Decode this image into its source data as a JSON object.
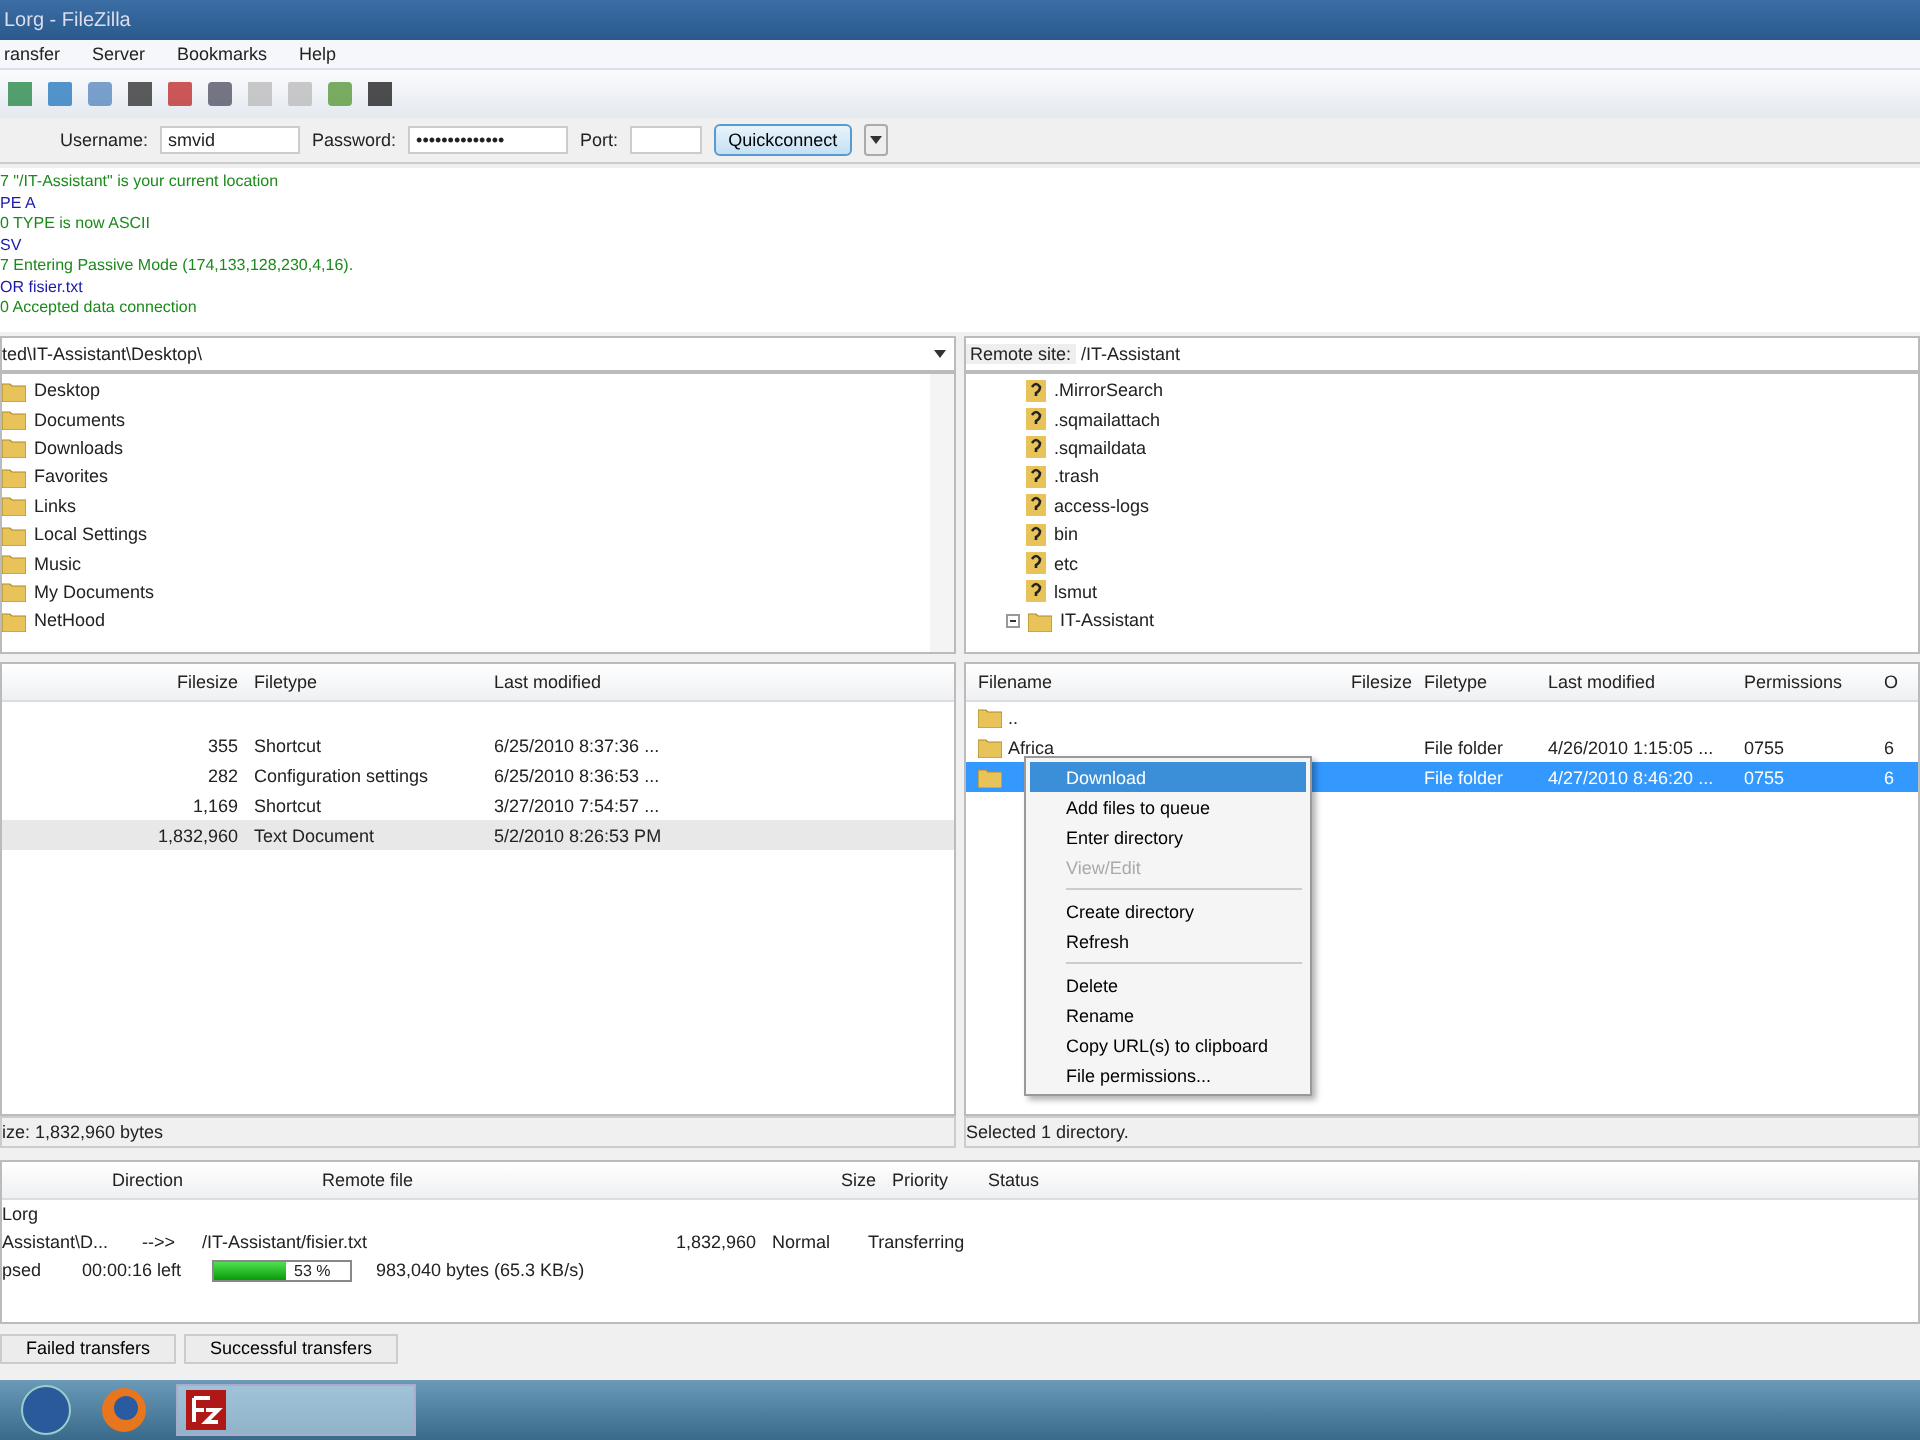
{
  "window": {
    "title": "Lorg - FileZilla"
  },
  "menu": [
    "ransfer",
    "Server",
    "Bookmarks",
    "Help"
  ],
  "quickconnect": {
    "username_label": "Username:",
    "username": "smvid",
    "password_label": "Password:",
    "password": "••••••••••••••",
    "port_label": "Port:",
    "button": "Quickconnect"
  },
  "log": [
    {
      "text": "7 \"/IT-Assistant\" is your current location",
      "kind": "reply"
    },
    {
      "text": "PE A",
      "kind": "command"
    },
    {
      "text": "0 TYPE is now ASCII",
      "kind": "reply"
    },
    {
      "text": "SV",
      "kind": "command"
    },
    {
      "text": "7 Entering Passive Mode (174,133,128,230,4,16).",
      "kind": "reply"
    },
    {
      "text": "OR fisier.txt",
      "kind": "command"
    },
    {
      "text": "0 Accepted data connection",
      "kind": "reply"
    }
  ],
  "local": {
    "path": "ted\\IT-Assistant\\Desktop\\",
    "tree": [
      {
        "name": "Desktop"
      },
      {
        "name": "Documents"
      },
      {
        "name": "Downloads"
      },
      {
        "name": "Favorites"
      },
      {
        "name": "Links"
      },
      {
        "name": "Local Settings"
      },
      {
        "name": "Music"
      },
      {
        "name": "My Documents"
      },
      {
        "name": "NetHood"
      }
    ],
    "columns": [
      "Filesize",
      "Filetype",
      "Last modified"
    ],
    "rows": [
      {
        "cells": [
          "355",
          "Shortcut",
          "6/25/2010 8:37:36 ..."
        ],
        "selected": false
      },
      {
        "cells": [
          "282",
          "Configuration settings",
          "6/25/2010 8:36:53 ..."
        ],
        "selected": false
      },
      {
        "cells": [
          "1,169",
          "Shortcut",
          "3/27/2010 7:54:57 ..."
        ],
        "selected": false
      },
      {
        "cells": [
          "1,832,960",
          "Text Document",
          "5/2/2010 8:26:53 PM"
        ],
        "selected": true
      }
    ],
    "status": "ize: 1,832,960 bytes"
  },
  "remote": {
    "site_label": "Remote site:",
    "path": "/IT-Assistant",
    "tree": [
      {
        "name": ".MirrorSearch",
        "expanded": false
      },
      {
        "name": ".sqmailattach",
        "expanded": false
      },
      {
        "name": ".sqmaildata",
        "expanded": false
      },
      {
        "name": ".trash",
        "expanded": false
      },
      {
        "name": "access-logs",
        "expanded": false
      },
      {
        "name": "bin",
        "expanded": false
      },
      {
        "name": "etc",
        "expanded": false
      },
      {
        "name": "lsmut",
        "expanded": false
      },
      {
        "name": "IT-Assistant",
        "expanded": true
      }
    ],
    "columns": [
      "Filename",
      "Filesize",
      "Filetype",
      "Last modified",
      "Permissions",
      "O"
    ],
    "rows": [
      {
        "cells": [
          "..",
          "",
          "",
          "",
          "",
          ""
        ],
        "selected": false
      },
      {
        "cells": [
          "Africa",
          "",
          "File folder",
          "4/26/2010 1:15:05 ...",
          "0755",
          "6"
        ],
        "selected": false
      },
      {
        "cells": [
          "",
          "",
          "File folder",
          "4/27/2010 8:46:20 ...",
          "0755",
          "6"
        ],
        "selected": true
      }
    ],
    "status": "Selected 1 directory."
  },
  "context_menu": [
    {
      "label": "Download",
      "kind": "item",
      "selected": true,
      "disabled": false
    },
    {
      "label": "Add files to queue",
      "kind": "item",
      "selected": false,
      "disabled": false
    },
    {
      "label": "Enter directory",
      "kind": "item",
      "selected": false,
      "disabled": false
    },
    {
      "label": "View/Edit",
      "kind": "item",
      "selected": false,
      "disabled": true
    },
    {
      "kind": "separator"
    },
    {
      "label": "Create directory",
      "kind": "item",
      "selected": false,
      "disabled": false
    },
    {
      "label": "Refresh",
      "kind": "item",
      "selected": false,
      "disabled": false
    },
    {
      "kind": "separator"
    },
    {
      "label": "Delete",
      "kind": "item",
      "selected": false,
      "disabled": false
    },
    {
      "label": "Rename",
      "kind": "item",
      "selected": false,
      "disabled": false
    },
    {
      "label": "Copy URL(s) to clipboard",
      "kind": "item",
      "selected": false,
      "disabled": false
    },
    {
      "label": "File permissions...",
      "kind": "item",
      "selected": false,
      "disabled": false
    }
  ],
  "queue": {
    "columns": [
      "Direction",
      "Remote file",
      "Size",
      "Priority",
      "Status"
    ],
    "server": "Lorg",
    "transfer": {
      "local": "Assistant\\D...",
      "direction": "-->>",
      "remote": "/IT-Assistant/fisier.txt",
      "size": "1,832,960",
      "priority": "Normal",
      "status": "Transferring"
    },
    "progress": {
      "elapsed": "psed",
      "left": "00:00:16 left",
      "level": 0.53,
      "percent": "53 %",
      "bytes": "983,040 bytes (65.3 KB/s)"
    }
  },
  "tabs": [
    {
      "label": "Failed transfers",
      "selected": false
    },
    {
      "label": "Successful transfers",
      "selected": false
    }
  ]
}
